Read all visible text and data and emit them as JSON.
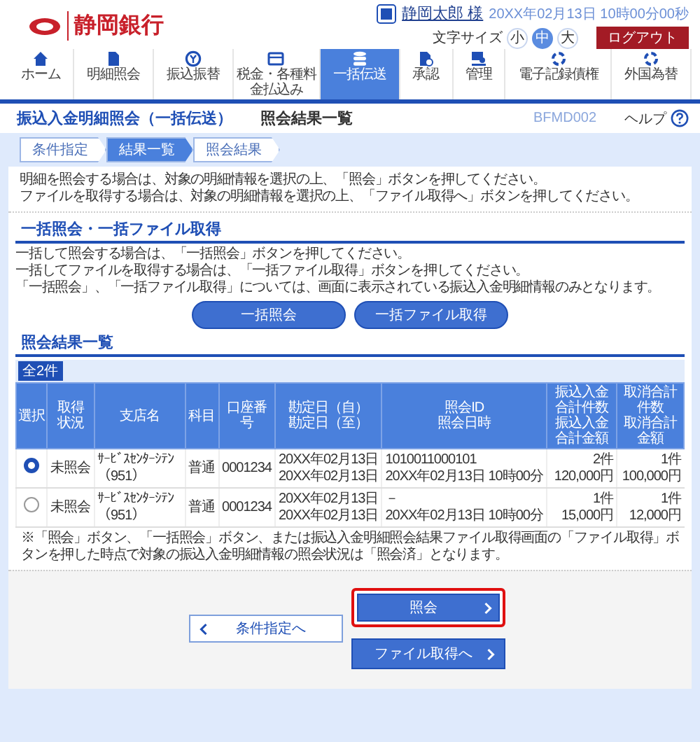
{
  "header": {
    "bank_name": "静岡銀行",
    "user_name": "静岡太郎 様",
    "datetime": "20XX年02月13日 10時00分00秒",
    "font_size": {
      "label": "文字サイズ",
      "options": [
        {
          "label": "小",
          "selected": false
        },
        {
          "label": "中",
          "selected": true
        },
        {
          "label": "大",
          "selected": false
        }
      ]
    },
    "logout": "ログアウト"
  },
  "nav": [
    {
      "label": "ホーム",
      "selected": false
    },
    {
      "label": "明細照会",
      "selected": false
    },
    {
      "label": "振込振替",
      "selected": false
    },
    {
      "label": "税金・各種料金払込み",
      "selected": false
    },
    {
      "label": "一括伝送",
      "selected": true
    },
    {
      "label": "承認",
      "selected": false
    },
    {
      "label": "管理",
      "selected": false
    },
    {
      "label": "電子記録債権",
      "selected": false
    },
    {
      "label": "外国為替",
      "selected": false
    }
  ],
  "title_bar": {
    "service": "振込入金明細照会（一括伝送）",
    "screen": "照会結果一覧",
    "screen_id": "BFMD002",
    "help": "ヘルプ"
  },
  "steps": [
    {
      "label": "条件指定",
      "selected": false
    },
    {
      "label": "結果一覧",
      "selected": true
    },
    {
      "label": "照会結果",
      "selected": false
    }
  ],
  "intro": [
    "明細を照会する場合は、対象の明細情報を選択の上、「照会」ボタンを押してください。",
    "ファイルを取得する場合は、対象の明細情報を選択の上、「ファイル取得へ」ボタンを押してください。"
  ],
  "bulk": {
    "heading": "一括照会・一括ファイル取得",
    "lines": [
      "一括して照会する場合は、「一括照会」ボタンを押してください。",
      "一括してファイルを取得する場合は、「一括ファイル取得」ボタンを押してください。",
      "「一括照会」、「一括ファイル取得」については、画面に表示されている振込入金明細情報のみとなります。"
    ],
    "buttons": [
      "一括照会",
      "一括ファイル取得"
    ]
  },
  "results": {
    "heading": "照会結果一覧",
    "count": "全2件",
    "columns": [
      {
        "lines": [
          "選択"
        ]
      },
      {
        "lines": [
          "取得",
          "状況"
        ]
      },
      {
        "lines": [
          "支店名"
        ]
      },
      {
        "lines": [
          "科目"
        ]
      },
      {
        "lines": [
          "口座番号"
        ]
      },
      {
        "lines": [
          "勘定日（自）",
          "勘定日（至）"
        ]
      },
      {
        "lines": [
          "照会ID",
          "照会日時"
        ]
      },
      {
        "lines": [
          "振込入金合計件数",
          "振込入金合計金額"
        ]
      },
      {
        "lines": [
          "取消合計件数",
          "取消合計金額"
        ]
      }
    ],
    "rows": [
      {
        "selected": true,
        "status": "未照会",
        "branch": "ｻｰﾋﾞｽｾﾝﾀｰｼﾃﾝ（951）",
        "subject": "普通",
        "account": "0001234",
        "date_from": "20XX年02月13日",
        "date_to": "20XX年02月13日",
        "inquiry_id": "1010011000101",
        "inquiry_datetime": "20XX年02月13日 10時00分",
        "transfer_count": "2件",
        "transfer_amount": "120,000円",
        "cancel_count": "1件",
        "cancel_amount": "100,000円"
      },
      {
        "selected": false,
        "status": "未照会",
        "branch": "ｻｰﾋﾞｽｾﾝﾀｰｼﾃﾝ（951）",
        "subject": "普通",
        "account": "0001234",
        "date_from": "20XX年02月13日",
        "date_to": "20XX年02月13日",
        "inquiry_id": "－",
        "inquiry_datetime": "20XX年02月13日 10時00分",
        "transfer_count": "1件",
        "transfer_amount": "15,000円",
        "cancel_count": "1件",
        "cancel_amount": "12,000円"
      }
    ]
  },
  "note": "※「照会」ボタン、「一括照会」ボタン、または振込入金明細照会結果ファイル取得画面の「ファイル取得」ボタンを押した時点で対象の振込入金明細情報の照会状況は「照会済」となります。",
  "footer": {
    "back_button": "条件指定へ",
    "buttons": [
      {
        "label": "照会",
        "highlighted": true
      },
      {
        "label": "ファイル取得へ",
        "highlighted": false
      }
    ]
  }
}
